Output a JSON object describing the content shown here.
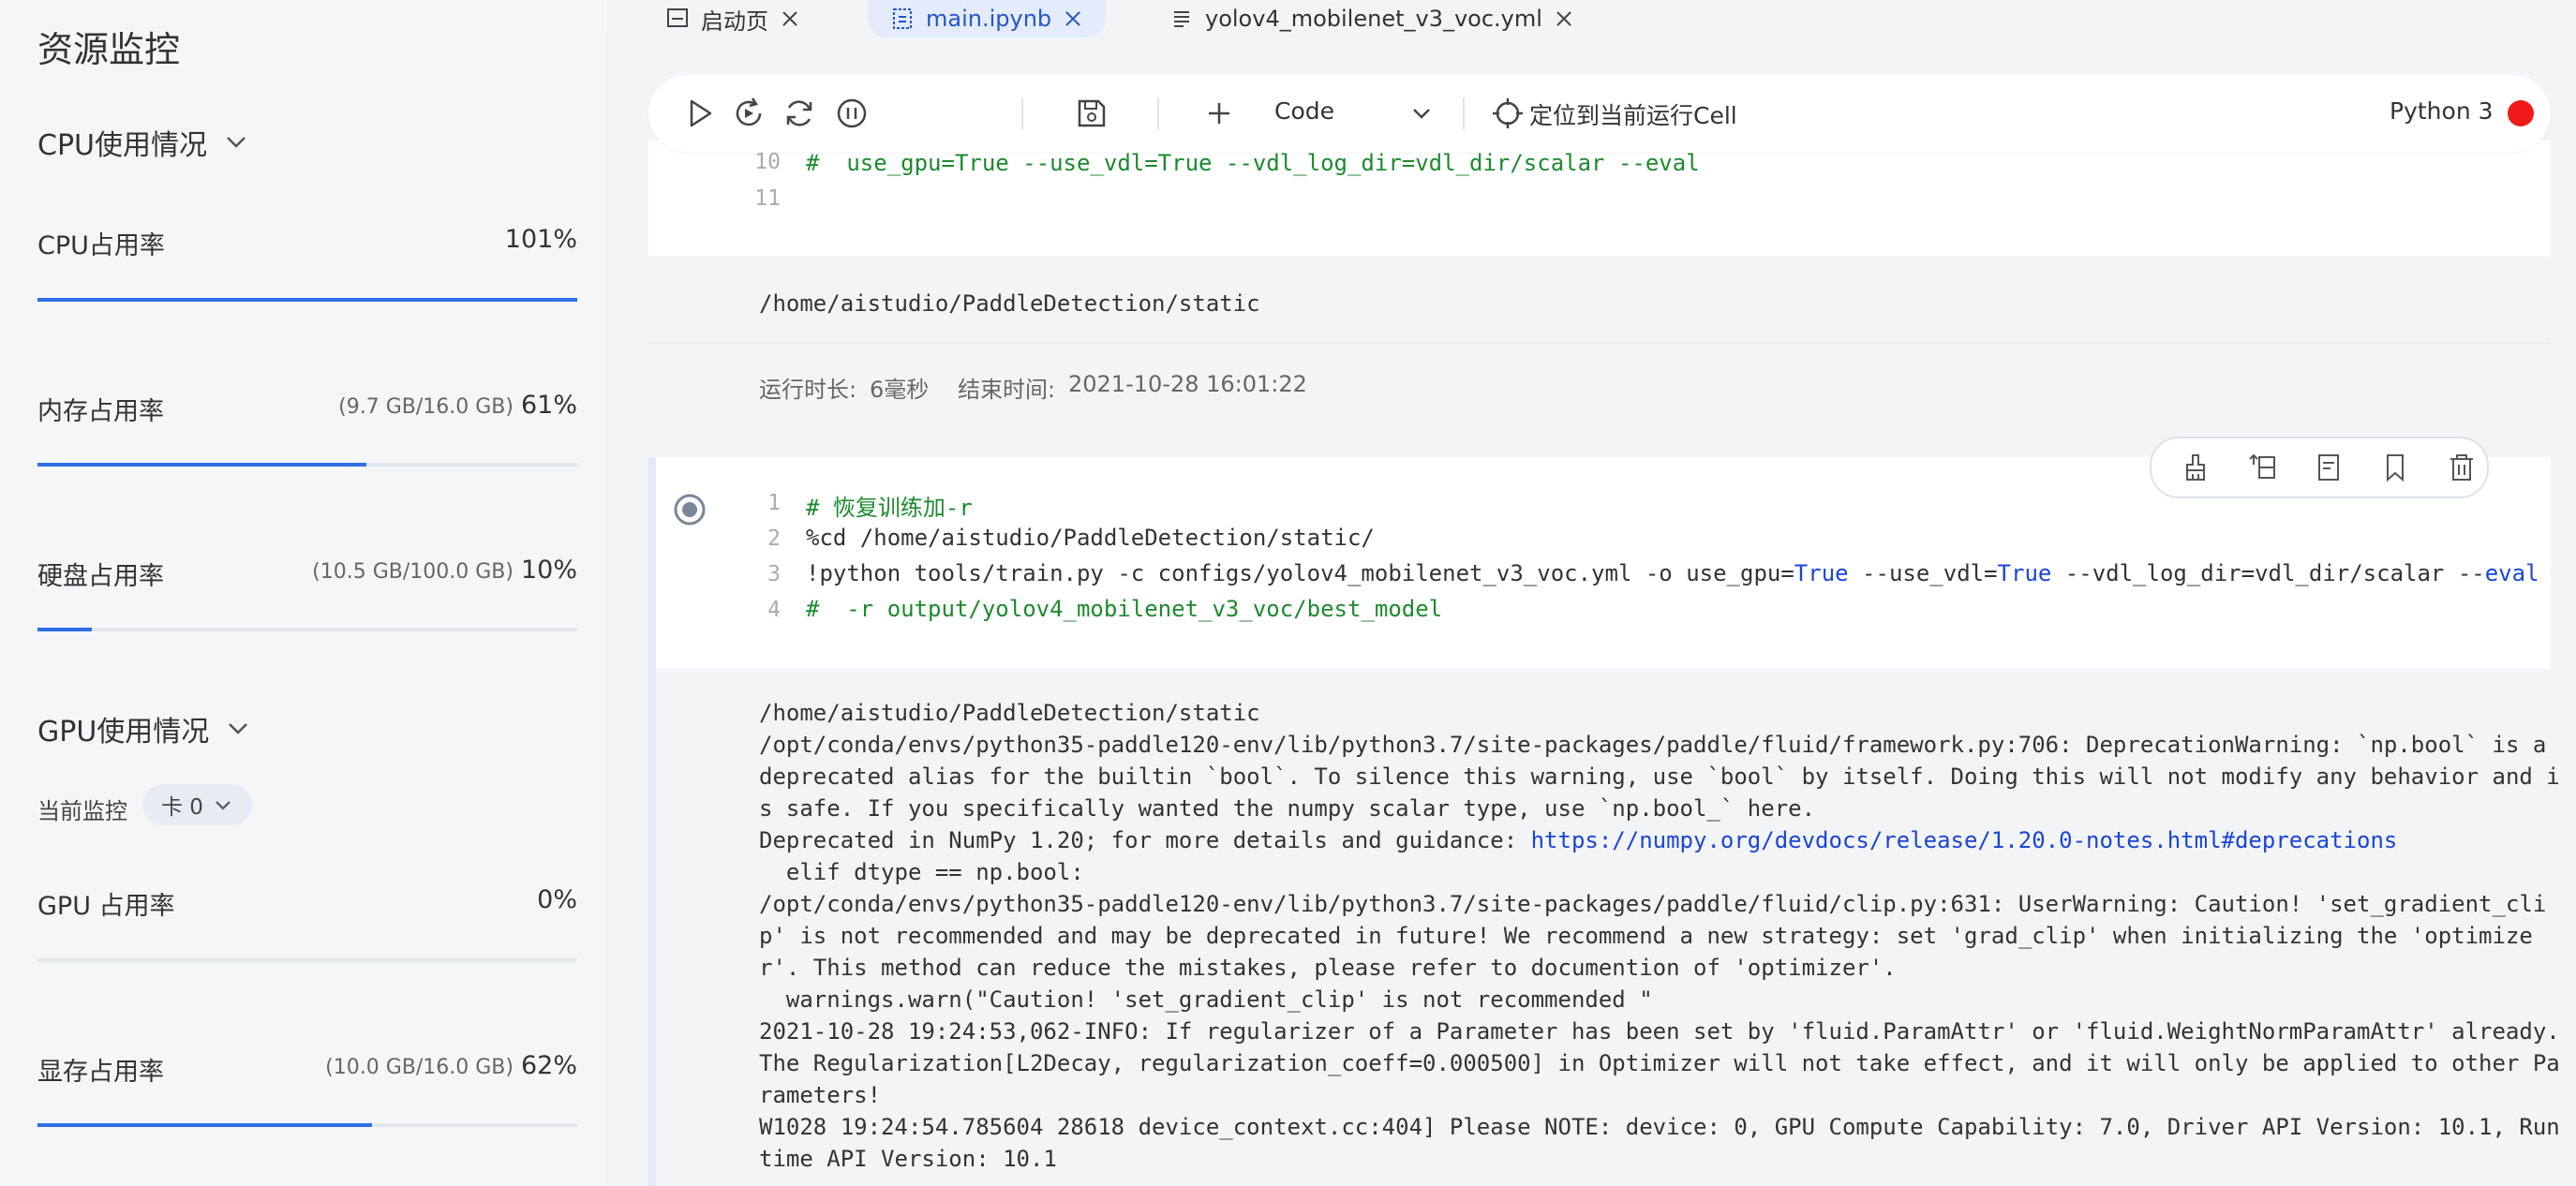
{
  "sidebar": {
    "title": "资源监控",
    "cpu_section": "CPU使用情况",
    "gpu_section": "GPU使用情况",
    "metrics": [
      {
        "name": "CPU占用率",
        "detail": "",
        "percent": "101%",
        "fill": 1.0
      },
      {
        "name": "内存占用率",
        "detail": "(9.7 GB/16.0 GB)",
        "percent": "61%",
        "fill": 0.61
      },
      {
        "name": "硬盘占用率",
        "detail": "(10.5 GB/100.0 GB)",
        "percent": "10%",
        "fill": 0.1
      }
    ],
    "monitor_label": "当前监控",
    "card_select": "卡 0",
    "gpu_metrics": [
      {
        "name": "GPU 占用率",
        "detail": "",
        "percent": "0%",
        "fill": 0.0
      },
      {
        "name": "显存占用率",
        "detail": "(10.0 GB/16.0 GB)",
        "percent": "62%",
        "fill": 0.62
      }
    ]
  },
  "tabs": [
    {
      "label": "启动页",
      "icon": "launcher-icon",
      "active": false
    },
    {
      "label": "main.ipynb",
      "icon": "notebook-icon",
      "active": true
    },
    {
      "label": "yolov4_mobilenet_v3_voc.yml",
      "icon": "text-file-icon",
      "active": false
    }
  ],
  "toolbar": {
    "cell_type": "Code",
    "locate_label": "定位到当前运行Cell",
    "kernel_name": "Python 3",
    "kernel_status_color": "#f01919"
  },
  "cell_top": {
    "lines": [
      {
        "n": "10",
        "text": "#  use_gpu=True --use_vdl=True --vdl_log_dir=vdl_dir/scalar --eval"
      },
      {
        "n": "11",
        "text": ""
      }
    ],
    "output": "/home/aistudio/PaddleDetection/static",
    "runtime_label": "运行时长:",
    "runtime_value": "6毫秒",
    "end_label": "结束时间:",
    "end_value": "2021-10-28 16:01:22"
  },
  "cell_main": {
    "line_numbers": [
      "1",
      "2",
      "3",
      "4"
    ],
    "line1": "# 恢复训练加-r",
    "line2": "%cd /home/aistudio/PaddleDetection/static/",
    "line3": {
      "a": "!python tools/train.py -c configs/yolov4_mobilenet_v3_voc.yml -o use_gpu=",
      "b": "True",
      "c": " --use_vdl=",
      "d": "True",
      "e": " --vdl_log_dir=vdl_dir/scalar --",
      "f": "eval"
    },
    "line4": "#  -r output/yolov4_mobilenet_v3_voc/best_model"
  },
  "output_main": {
    "lines": [
      "/home/aistudio/PaddleDetection/static",
      "/opt/conda/envs/python35-paddle120-env/lib/python3.7/site-packages/paddle/fluid/framework.py:706: DeprecationWarning: `np.bool` is a",
      "deprecated alias for the builtin `bool`. To silence this warning, use `bool` by itself. Doing this will not modify any behavior and i",
      "s safe. If you specifically wanted the numpy scalar type, use `np.bool_` here."
    ],
    "deprecated_prefix": "Deprecated in NumPy 1.20; for more details and guidance: ",
    "deprecated_link": "https://numpy.org/devdocs/release/1.20.0-notes.html#deprecations",
    "lines2": [
      "  elif dtype == np.bool:",
      "/opt/conda/envs/python35-paddle120-env/lib/python3.7/site-packages/paddle/fluid/clip.py:631: UserWarning: Caution! 'set_gradient_cli",
      "p' is not recommended and may be deprecated in future! We recommend a new strategy: set 'grad_clip' when initializing the 'optimize",
      "r'. This method can reduce the mistakes, please refer to documention of 'optimizer'.",
      "  warnings.warn(\"Caution! 'set_gradient_clip' is not recommended \"",
      "2021-10-28 19:24:53,062-INFO: If regularizer of a Parameter has been set by 'fluid.ParamAttr' or 'fluid.WeightNormParamAttr' already.",
      "The Regularization[L2Decay, regularization_coeff=0.000500] in Optimizer will not take effect, and it will only be applied to other Pa",
      "rameters!",
      "W1028 19:24:54.785604 28618 device_context.cc:404] Please NOTE: device: 0, GPU Compute Capability: 7.0, Driver API Version: 10.1, Run",
      "time API Version: 10.1"
    ]
  },
  "colors": {
    "accent": "#2f6fe4",
    "code_comment": "#1c8a2d",
    "code_keyword": "#1a45d6"
  }
}
